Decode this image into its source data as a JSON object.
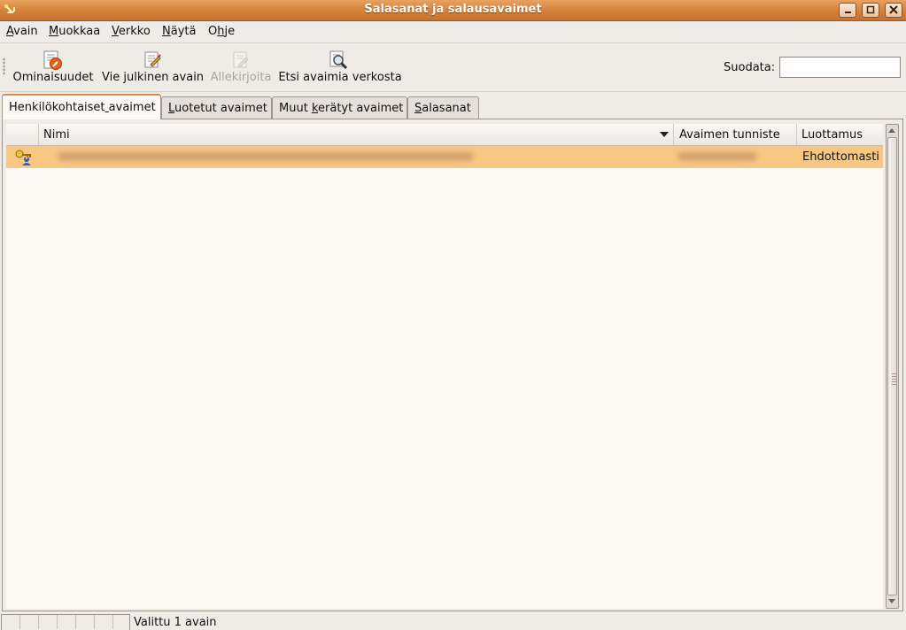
{
  "window": {
    "title": "Salasanat ja salausavaimet",
    "accent_color": "#d3803a",
    "controls": [
      "minimize-icon",
      "maximize-icon",
      "close-icon"
    ]
  },
  "menubar": {
    "items": [
      {
        "label": "Avain",
        "mnemonic_index": 0
      },
      {
        "label": "Muokkaa",
        "mnemonic_index": 0
      },
      {
        "label": "Verkko",
        "mnemonic_index": 0
      },
      {
        "label": "Näytä",
        "mnemonic_index": 0
      },
      {
        "label": "Ohje",
        "mnemonic_index": 1
      }
    ]
  },
  "toolbar": {
    "properties": {
      "label": "Ominaisuudet",
      "icon": "properties-icon",
      "enabled": true
    },
    "export": {
      "label": "Vie julkinen avain",
      "icon": "export-key-icon",
      "enabled": true
    },
    "sign": {
      "label": "Allekirjoita",
      "icon": "sign-icon",
      "enabled": false
    },
    "search": {
      "label": "Etsi avaimia verkosta",
      "icon": "search-remote-icon",
      "enabled": true
    },
    "filter_label": "Suodata:",
    "filter_value": ""
  },
  "tabs": [
    {
      "label": "Henkilökohtaiset avaimet",
      "active": true
    },
    {
      "label": "Luotetut avaimet",
      "active": false
    },
    {
      "label": "Muut kerätyt avaimet",
      "active": false
    },
    {
      "label": "Salasanat",
      "active": false
    }
  ],
  "table": {
    "columns": {
      "name": "Nimi",
      "key_id": "Avaimen tunniste",
      "trust": "Luottamus"
    },
    "rows": [
      {
        "icon": "keypair-icon",
        "name": "",
        "key_id": "",
        "trust": "Ehdottomasti",
        "selected": true
      }
    ],
    "selected_color": "#f8c782"
  },
  "status": {
    "text": "Valittu 1 avain"
  }
}
